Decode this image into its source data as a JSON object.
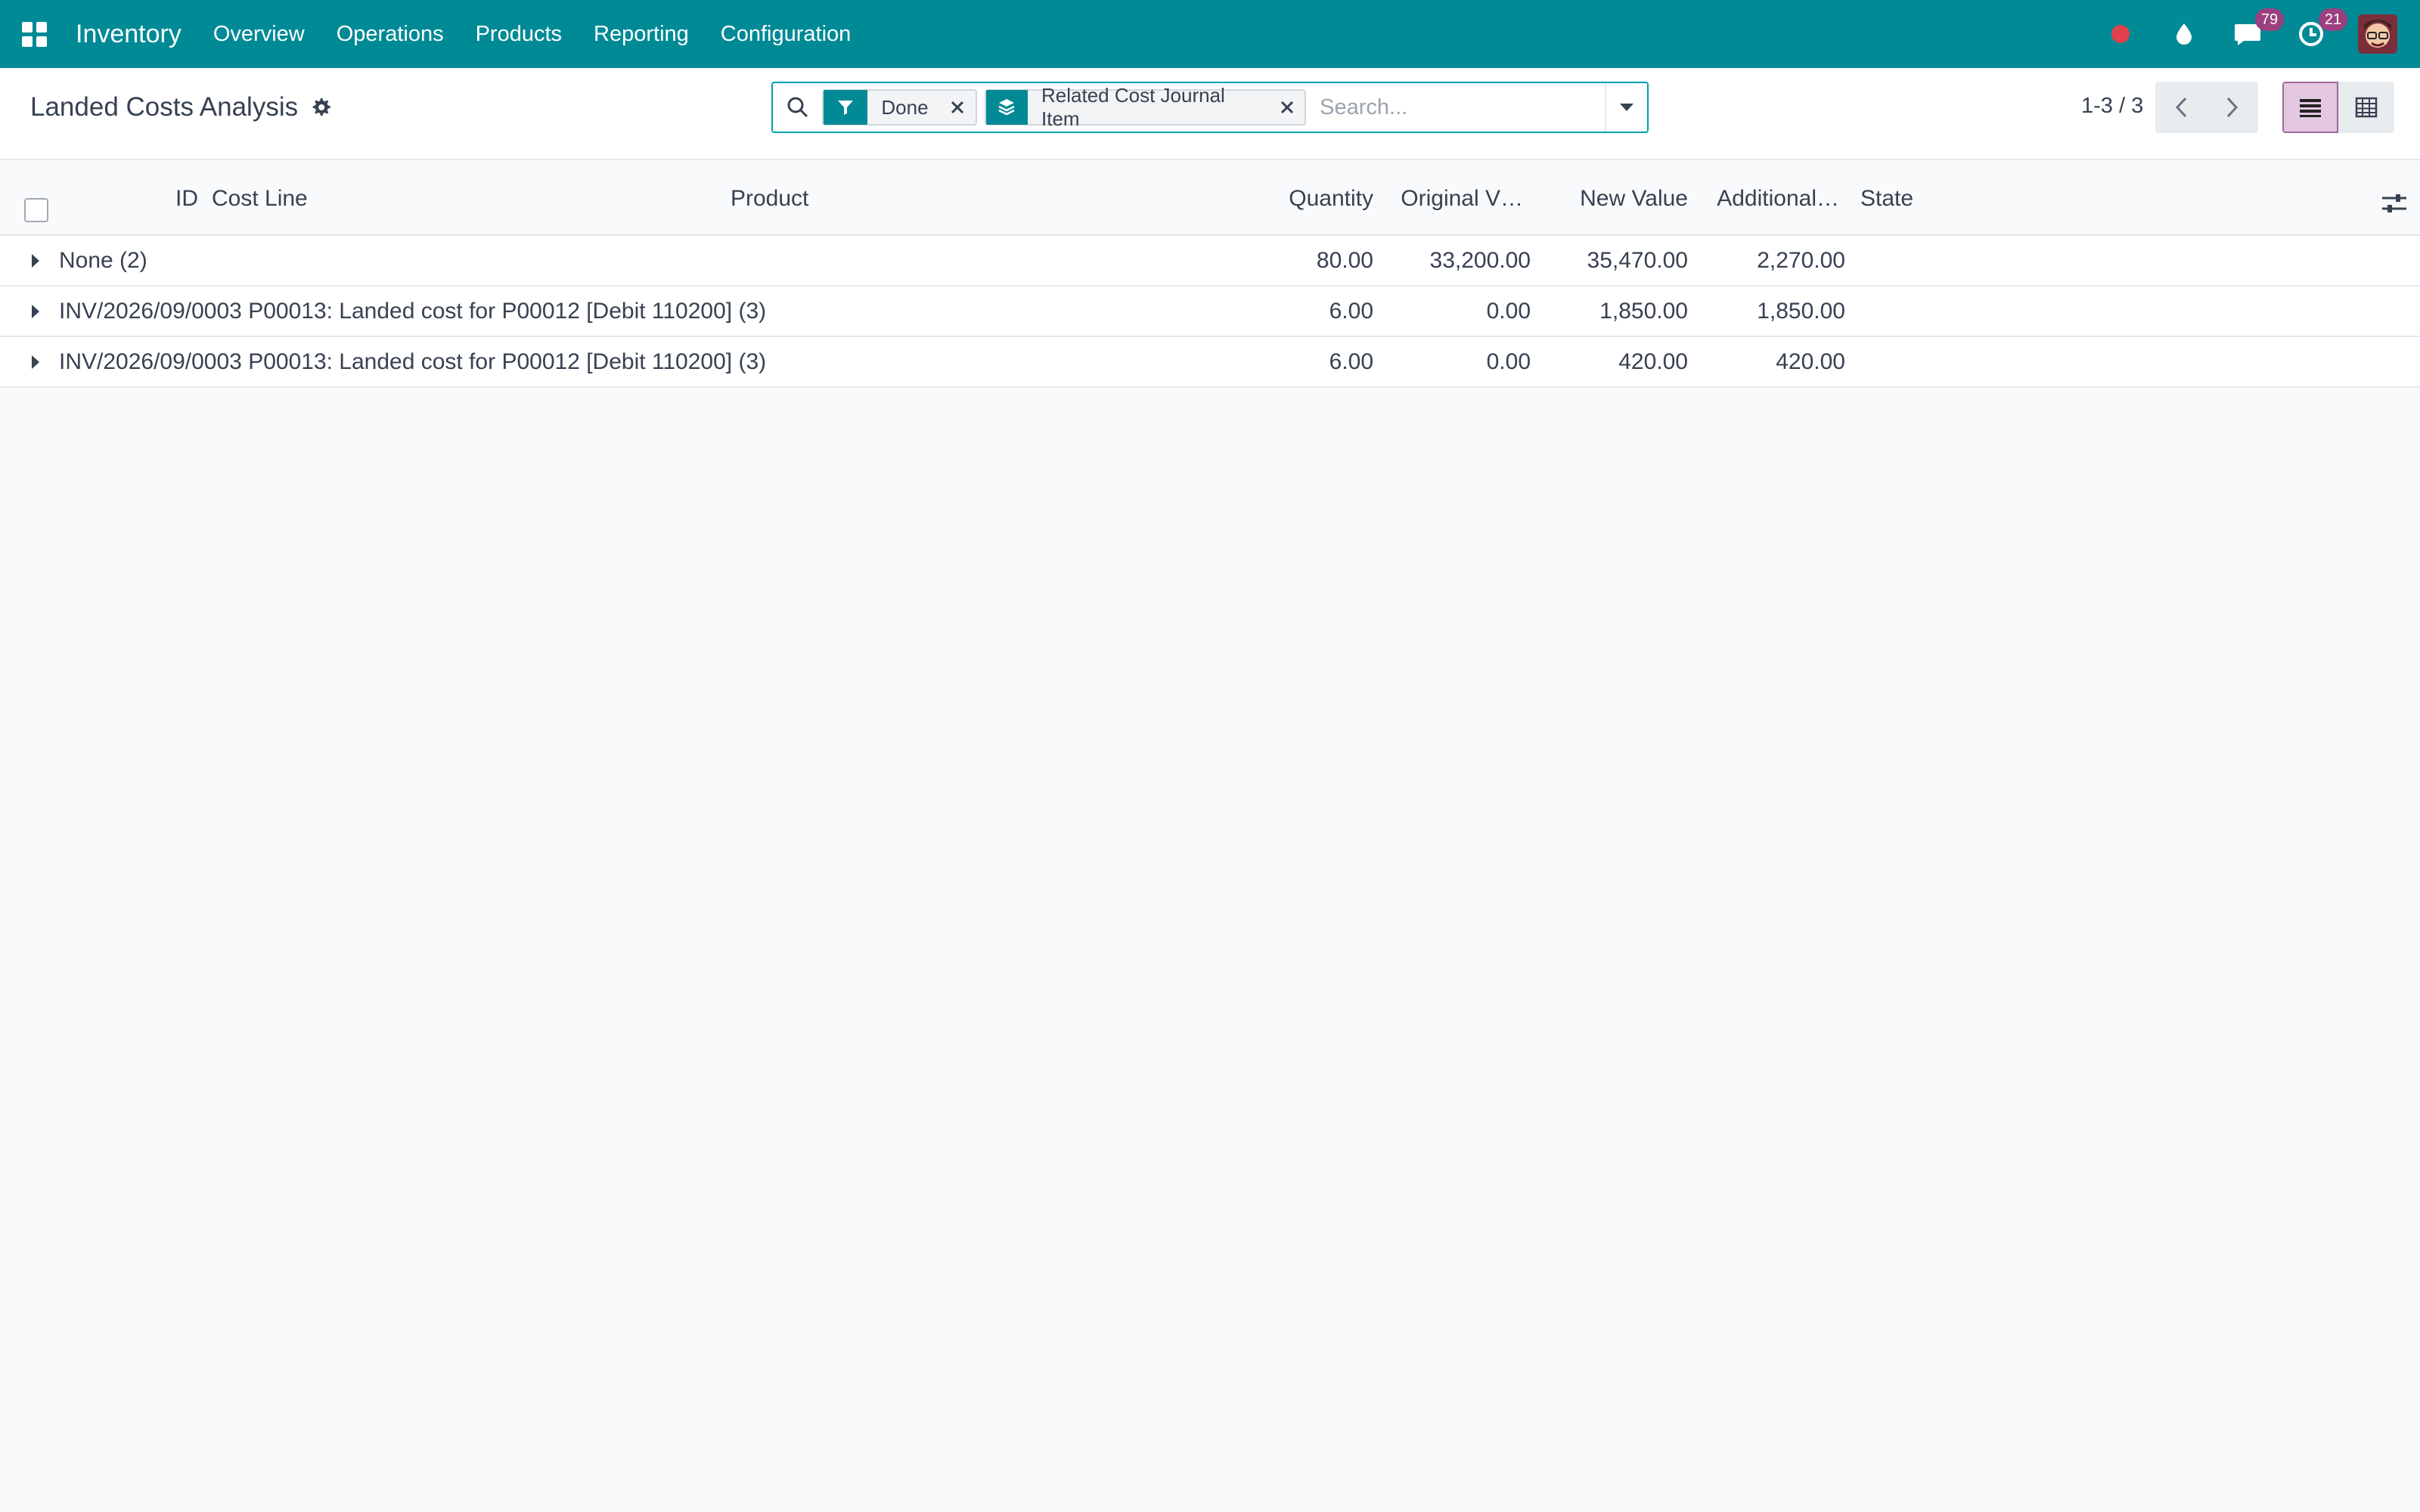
{
  "navbar": {
    "app_name": "Inventory",
    "menu": [
      "Overview",
      "Operations",
      "Products",
      "Reporting",
      "Configuration"
    ],
    "messages_badge": "79",
    "activities_badge": "21"
  },
  "control": {
    "title": "Landed Costs Analysis",
    "facets": [
      {
        "icon": "filter-icon",
        "label": "Done"
      },
      {
        "icon": "layers-icon",
        "label": "Related Cost Journal Item"
      }
    ],
    "search_placeholder": "Search...",
    "pager": "1-3 / 3"
  },
  "table": {
    "headers": {
      "id": "ID",
      "cost_line": "Cost Line",
      "product": "Product",
      "quantity": "Quantity",
      "original_value": "Original V…",
      "new_value": "New Value",
      "additional": "Additional…",
      "state": "State"
    },
    "groups": [
      {
        "label": "None (2)",
        "quantity": "80.00",
        "original_value": "33,200.00",
        "new_value": "35,470.00",
        "additional": "2,270.00"
      },
      {
        "label": "INV/2026/09/0003 P00013: Landed cost for P00012 [Debit 110200] (3)",
        "quantity": "6.00",
        "original_value": "0.00",
        "new_value": "1,850.00",
        "additional": "1,850.00"
      },
      {
        "label": "INV/2026/09/0003 P00013: Landed cost for P00012 [Debit 110200] (3)",
        "quantity": "6.00",
        "original_value": "0.00",
        "new_value": "420.00",
        "additional": "420.00"
      }
    ]
  },
  "colors": {
    "navbar": "#008a96",
    "accent": "#00a0ae",
    "badge": "#9b3f7f",
    "record": "#e0414a",
    "active_view": "#e4c7e1"
  }
}
